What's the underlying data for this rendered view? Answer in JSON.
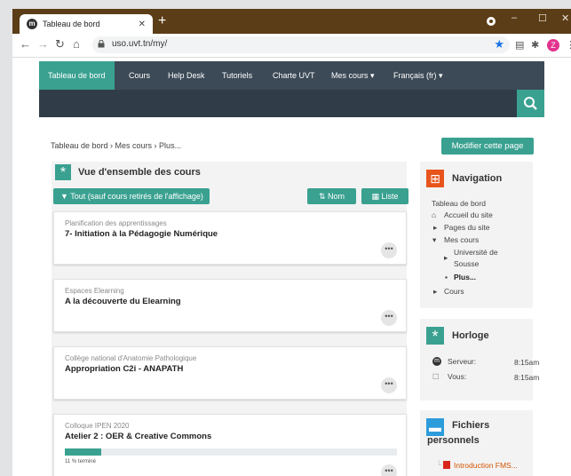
{
  "browser": {
    "tab_title": "Tableau de bord",
    "new_tab": "+",
    "url": "uso.uvt.tn/my/",
    "profile_initial": "Z"
  },
  "topnav": {
    "items": [
      "Tableau de bord",
      "Cours",
      "Help Desk",
      "Tutoriels",
      "Charte UVT",
      "Mes cours ▾",
      "Français ‎(fr)‎ ▾"
    ]
  },
  "breadcrumb": "Tableau de bord › Mes cours › Plus...",
  "edit_button": "Modifier cette page",
  "overview": {
    "title": "Vue d'ensemble des cours",
    "filter_label": "Tout (sauf cours retirés de l'affichage)",
    "sort_name": "Nom",
    "view_list": "Liste",
    "more_label": "•••",
    "courses": [
      {
        "category": "Planification des apprentissages",
        "name": "7- Initiation à la Pédagogie Numérique"
      },
      {
        "category": "Espaces Elearning",
        "name": "A la découverte du Elearning"
      },
      {
        "category": "Collège national d'Anatomie Pathologique",
        "name": "Appropriation C2i - ANAPATH"
      },
      {
        "category": "Colloque IPEN 2020",
        "name": "Atelier 2 : OER & Creative Commons",
        "progress": 11,
        "progress_label": "11 % terminé"
      }
    ]
  },
  "navigation": {
    "title": "Navigation",
    "items": [
      "Tableau de bord",
      "Accueil du site",
      "Pages du site",
      "Mes cours",
      "Université de",
      "Sousse",
      "Plus...",
      "Cours"
    ]
  },
  "clock": {
    "title": "Horloge",
    "server_label": "Serveur:",
    "server_time": "8:15am",
    "you_label": "Vous:",
    "you_time": "8:15am"
  },
  "files": {
    "title_line1": "Fichiers",
    "title_line2": "personnels",
    "file_name": "Introduction FMS..."
  },
  "colors": {
    "accent": "#3aa191",
    "navbar": "#3c4a57",
    "chrome": "#5b3d17"
  }
}
